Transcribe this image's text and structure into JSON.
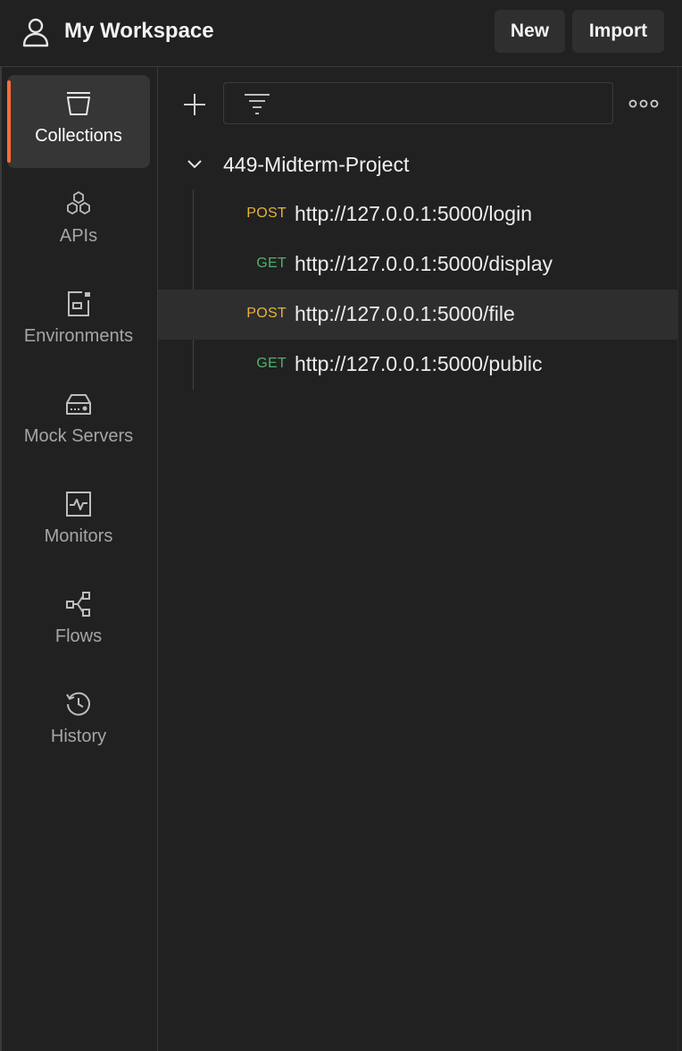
{
  "header": {
    "workspace_title": "My Workspace",
    "new_label": "New",
    "import_label": "Import"
  },
  "sidebar": {
    "items": [
      {
        "label": "Collections",
        "icon": "collections-icon",
        "active": true
      },
      {
        "label": "APIs",
        "icon": "apis-icon",
        "active": false
      },
      {
        "label": "Environments",
        "icon": "environments-icon",
        "active": false
      },
      {
        "label": "Mock Servers",
        "icon": "mock-servers-icon",
        "active": false
      },
      {
        "label": "Monitors",
        "icon": "monitors-icon",
        "active": false
      },
      {
        "label": "Flows",
        "icon": "flows-icon",
        "active": false
      },
      {
        "label": "History",
        "icon": "history-icon",
        "active": false
      }
    ]
  },
  "toolbar": {
    "filter_placeholder": ""
  },
  "collection": {
    "name": "449-Midterm-Project",
    "expanded": true,
    "requests": [
      {
        "method": "POST",
        "url": "http://127.0.0.1:5000/login",
        "selected": false
      },
      {
        "method": "GET",
        "url": "http://127.0.0.1:5000/display",
        "selected": false
      },
      {
        "method": "POST",
        "url": "http://127.0.0.1:5000/file",
        "selected": true
      },
      {
        "method": "GET",
        "url": "http://127.0.0.1:5000/public",
        "selected": false
      }
    ]
  },
  "colors": {
    "accent": "#ff6c37",
    "post": "#e8b33a",
    "get": "#4fb26b",
    "background": "#212121"
  }
}
